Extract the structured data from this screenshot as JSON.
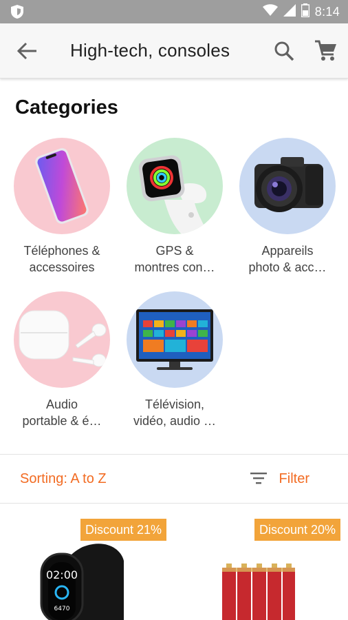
{
  "status_bar": {
    "time": "8:14"
  },
  "app_bar": {
    "title": "High-tech, consoles"
  },
  "categories": {
    "heading": "Categories",
    "items": [
      {
        "line1": "Téléphones &",
        "line2": "accessoires"
      },
      {
        "line1": "GPS &",
        "line2": "montres con…"
      },
      {
        "line1": "Appareils",
        "line2": "photo & acc…"
      },
      {
        "line1": "Audio",
        "line2": "portable & é…"
      },
      {
        "line1": "Télévision,",
        "line2": "vidéo, audio …"
      }
    ]
  },
  "sort_bar": {
    "sorting_label": "Sorting: A to Z",
    "filter_label": "Filter"
  },
  "products": [
    {
      "discount": "Discount 21%"
    },
    {
      "discount": "Discount 20%"
    }
  ],
  "colors": {
    "accent": "#f26b22",
    "badge": "#f2a43a",
    "pink": "#f9c9d0",
    "green": "#c8ecd0",
    "blue": "#c9d9f2"
  }
}
